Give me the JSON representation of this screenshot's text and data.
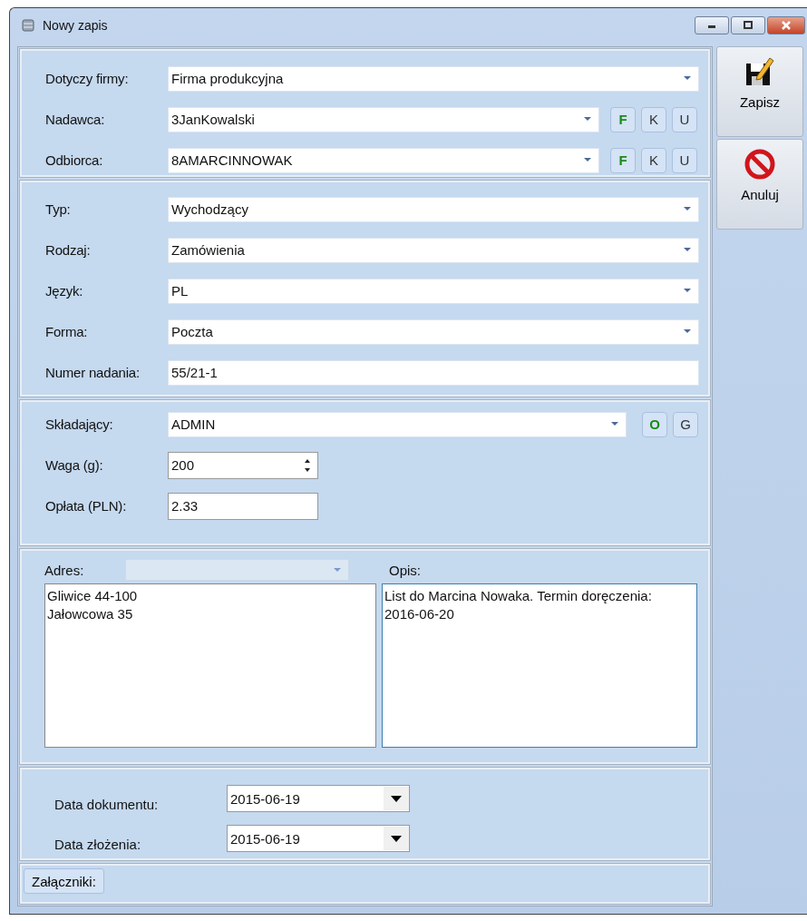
{
  "window": {
    "title": "Nowy zapis"
  },
  "sections": [
    {
      "rows": [
        {
          "kind": "combo",
          "label": "Dotyczy firmy:",
          "value": "Firma produkcyjna",
          "buttons": []
        },
        {
          "kind": "combo",
          "label": "Nadawca:",
          "value": "3JanKowalski",
          "buttons": [
            {
              "label": "F",
              "color": "#1a8a1a"
            },
            {
              "label": "K",
              "color": "#333333"
            },
            {
              "label": "U",
              "color": "#333333"
            }
          ]
        },
        {
          "kind": "combo",
          "label": "Odbiorca:",
          "value": "8AMARCINNOWAK",
          "buttons": [
            {
              "label": "F",
              "color": "#1a8a1a"
            },
            {
              "label": "K",
              "color": "#333333"
            },
            {
              "label": "U",
              "color": "#333333"
            }
          ]
        }
      ]
    },
    {
      "rows": [
        {
          "kind": "combo",
          "label": "Typ:",
          "value": "Wychodzący",
          "buttons": []
        },
        {
          "kind": "combo",
          "label": "Rodzaj:",
          "value": "Zamówienia",
          "buttons": []
        },
        {
          "kind": "combo",
          "label": "Język:",
          "value": "PL",
          "buttons": []
        },
        {
          "kind": "combo",
          "label": "Forma:",
          "value": "Poczta",
          "buttons": []
        },
        {
          "kind": "text",
          "label": "Numer nadania:",
          "value": "55/21-1",
          "buttons": []
        }
      ]
    },
    {
      "rows": [
        {
          "kind": "combo",
          "label": "Składający:",
          "value": "ADMIN",
          "buttons": [
            {
              "label": "O",
              "color": "#1a8a1a"
            },
            {
              "label": "G",
              "color": "#333333"
            }
          ]
        },
        {
          "kind": "spin",
          "label": "Waga (g):",
          "value": "200",
          "buttons": []
        },
        {
          "kind": "short",
          "label": "Opłata (PLN):",
          "value": "2.33",
          "buttons": []
        }
      ]
    }
  ],
  "address": {
    "label": "Adres:",
    "lines": [
      "Gliwice 44-100",
      "Jałowcowa 35"
    ],
    "focused": false
  },
  "description": {
    "label": "Opis:",
    "text": "List do Marcina Nowaka. Termin doręczenia: 2016-06-20",
    "focused": true
  },
  "dates": [
    {
      "label": "Data dokumentu:",
      "value": "2015-06-19"
    },
    {
      "label": "Data złożenia:",
      "value": "2015-06-19"
    }
  ],
  "attachments_tab": {
    "label": "Załączniki:"
  },
  "toolbar": [
    {
      "kind": "save",
      "label": "Zapisz"
    },
    {
      "kind": "cancel",
      "label": "Anuluj"
    }
  ]
}
